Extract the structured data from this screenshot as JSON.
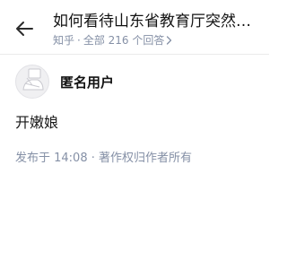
{
  "header": {
    "title": "如何看待山东省教育厅突然…",
    "source": "知乎",
    "separator": "·",
    "answers_link": "全部 216 个回答"
  },
  "answer": {
    "author_name": "匿名用户",
    "content": "开嫩娘",
    "meta": "发布于 14:08 · 著作权归作者所有"
  },
  "icons": {
    "back": "arrow-left-icon",
    "answers_chevron": "chevron-right-icon",
    "avatar": "anonymous-avatar-icon"
  },
  "colors": {
    "text_primary": "#121212",
    "text_secondary": "#8590a6",
    "divider": "#ebebeb",
    "avatar_bg": "#f0f0f2"
  }
}
